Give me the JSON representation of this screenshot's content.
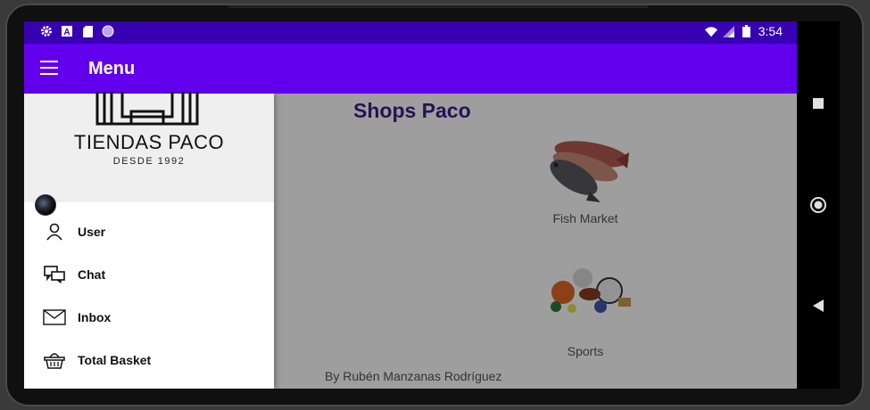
{
  "status_bar": {
    "time": "3:54",
    "left_icons": [
      "settings-icon",
      "a-icon",
      "sd-card-icon",
      "circle-icon"
    ],
    "right_icons": [
      "wifi-icon",
      "signal-icon",
      "battery-icon"
    ]
  },
  "app_bar": {
    "title": "Menu",
    "menu_icon": "hamburger-icon"
  },
  "drawer": {
    "header": {
      "brand_name": "TIENDAS PACO",
      "brand_since": "DESDE 1992"
    },
    "items": [
      {
        "label": "User",
        "icon": "user-icon"
      },
      {
        "label": "Chat",
        "icon": "chat-icon"
      },
      {
        "label": "Inbox",
        "icon": "inbox-icon"
      },
      {
        "label": "Total Basket",
        "icon": "basket-icon"
      }
    ]
  },
  "main": {
    "title": "Shops Paco",
    "shops": [
      {
        "label": "Fish Market",
        "icon": "fish-image"
      },
      {
        "label": "Sports",
        "icon": "sports-image"
      }
    ],
    "author": "By Rubén Manzanas Rodríguez"
  },
  "nav_bar": {
    "buttons": [
      "recents-icon",
      "home-icon",
      "back-icon"
    ]
  },
  "colors": {
    "status_bar": "#3700b3",
    "app_bar": "#6200ee",
    "title": "#3b1f8c"
  }
}
